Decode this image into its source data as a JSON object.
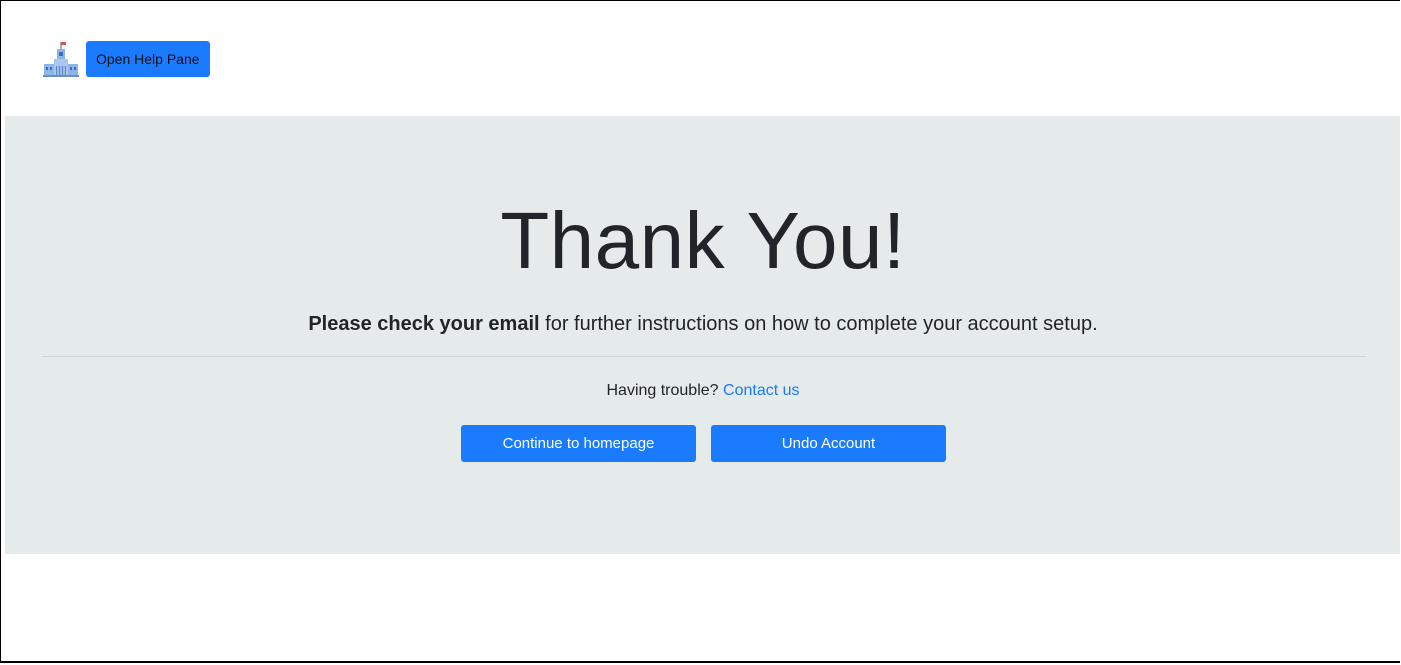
{
  "header": {
    "logo_icon": "city-hall-icon",
    "help_button_label": "Open Help Pane"
  },
  "main": {
    "title": "Thank You!",
    "message_bold": "Please check your email",
    "message_rest": " for further instructions on how to complete your account setup.",
    "trouble_text": "Having trouble?",
    "contact_link": "Contact us",
    "continue_button": "Continue to homepage",
    "undo_button": "Undo Account"
  },
  "colors": {
    "accent": "#1a7bff",
    "jumbotron_bg": "#e5eaea",
    "text": "#212529"
  }
}
